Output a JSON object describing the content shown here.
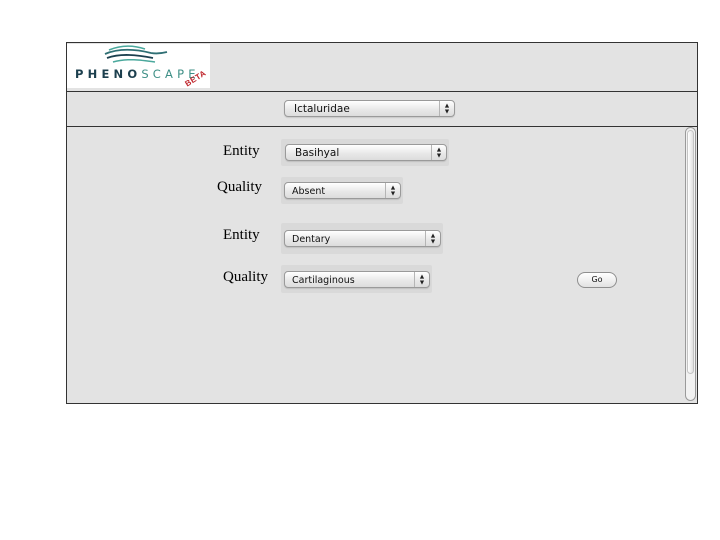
{
  "logo": {
    "text_dark": "PHENO",
    "text_light": "SCAPE",
    "badge": "BETA"
  },
  "taxon": {
    "selected": "Ictaluridae"
  },
  "query_rows": [
    {
      "entity_label": "Entity",
      "entity_value": "Basihyal",
      "quality_label": "Quality",
      "quality_value": "Absent"
    },
    {
      "entity_label": "Entity",
      "entity_value": "Dentary",
      "quality_label": "Quality",
      "quality_value": "Cartilaginous"
    }
  ],
  "go_button": {
    "label": "Go"
  },
  "colors": {
    "logo_dark": "#1c3f4e",
    "logo_light": "#3e8f86",
    "beta_red": "#c0262d",
    "panel_bg": "#e3e3e3"
  },
  "icons": {
    "select_arrows": "updown-arrows-icon",
    "logo_waves": "waves-icon"
  }
}
